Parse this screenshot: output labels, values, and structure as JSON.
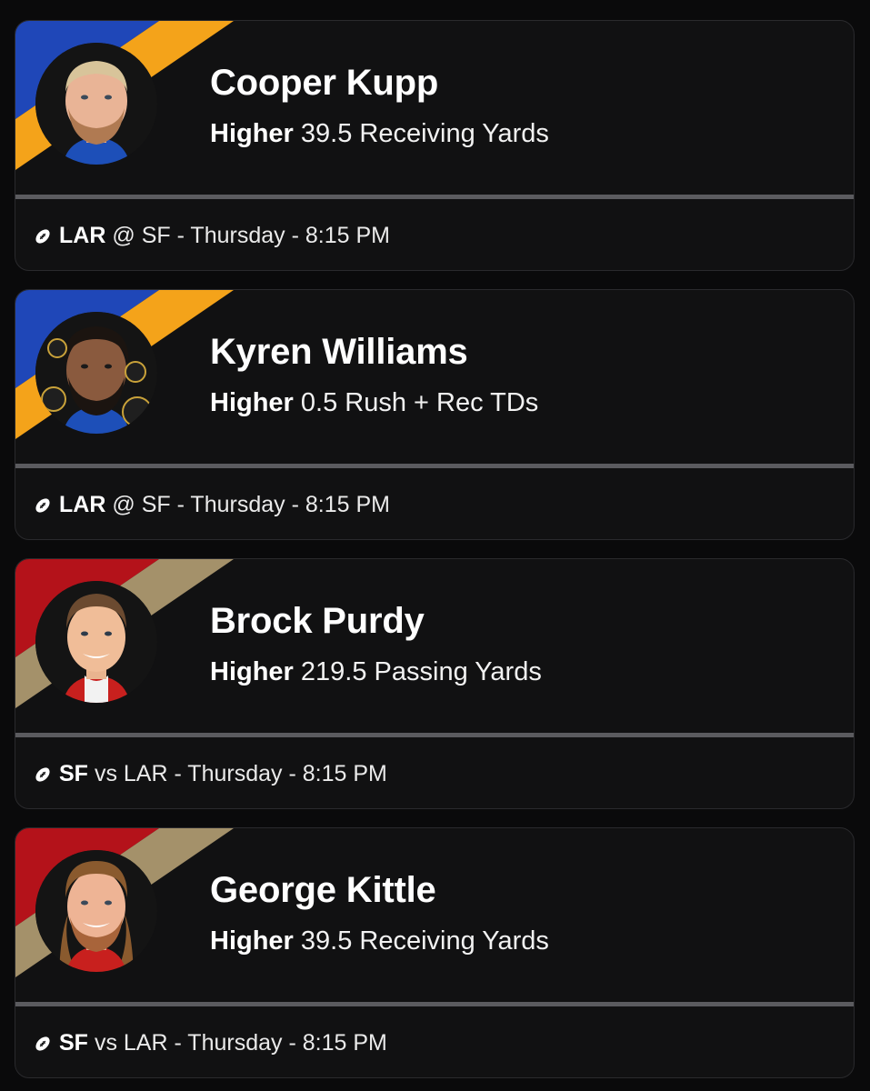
{
  "cards": [
    {
      "player": "Cooper Kupp",
      "direction": "Higher",
      "line": "39.5 Receiving Yards",
      "team": "LAR",
      "matchup": "@ SF - Thursday - 8:15 PM",
      "icon": "football-icon",
      "colors": {
        "stripe1": "#1f47b8",
        "stripe2": "#f4a31a",
        "jersey": "#1d4fb8"
      }
    },
    {
      "player": "Kyren Williams",
      "direction": "Higher",
      "line": "0.5 Rush + Rec TDs",
      "team": "LAR",
      "matchup": "@ SF - Thursday - 8:15 PM",
      "icon": "football-icon",
      "colors": {
        "stripe1": "#1f47b8",
        "stripe2": "#f4a31a",
        "jersey": "#1d4fb8"
      }
    },
    {
      "player": "Brock Purdy",
      "direction": "Higher",
      "line": "219.5 Passing Yards",
      "team": "SF",
      "matchup": "vs LAR - Thursday - 8:15 PM",
      "icon": "football-icon",
      "colors": {
        "stripe1": "#b4121a",
        "stripe2": "#a4916a",
        "jersey": "#c8201e"
      }
    },
    {
      "player": "George Kittle",
      "direction": "Higher",
      "line": "39.5 Receiving Yards",
      "team": "SF",
      "matchup": "vs LAR - Thursday - 8:15 PM",
      "icon": "football-icon",
      "colors": {
        "stripe1": "#b4121a",
        "stripe2": "#a4916a",
        "jersey": "#c8201e"
      }
    }
  ]
}
